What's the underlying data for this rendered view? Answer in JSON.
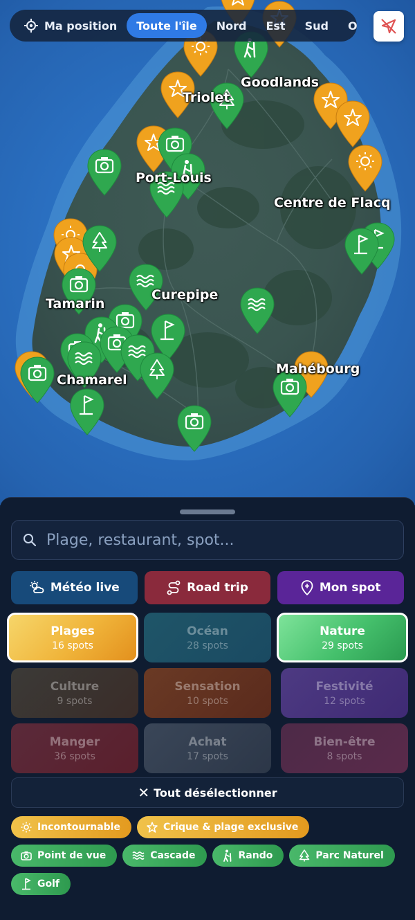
{
  "map": {
    "cities": [
      {
        "id": "goodlands",
        "label": "Goodlands"
      },
      {
        "id": "triolet",
        "label": "Triolet"
      },
      {
        "id": "port-louis",
        "label": "Port-Louis"
      },
      {
        "id": "centre-de-flacq",
        "label": "Centre de Flacq"
      },
      {
        "id": "tamarin",
        "label": "Tamarin"
      },
      {
        "id": "curepipe",
        "label": "Curepipe"
      },
      {
        "id": "chamarel",
        "label": "Chamarel"
      },
      {
        "id": "mahebourg",
        "label": "Mahébourg"
      }
    ],
    "pin_colors": {
      "gold": "#f0a21e",
      "green": "#2fa84f"
    }
  },
  "topbar": {
    "my_position": "Ma position",
    "filters": [
      "Toute l'île",
      "Nord",
      "Est",
      "Sud",
      "O"
    ],
    "active_filter": "Toute l'île"
  },
  "sheet": {
    "search": {
      "placeholder": "Plage, restaurant, spot..."
    },
    "actions": [
      {
        "id": "meteo",
        "label": "Météo live",
        "icon": "sun-cloud-icon",
        "color": "#174a7a"
      },
      {
        "id": "roadtrip",
        "label": "Road trip",
        "icon": "route-icon",
        "color": "#8a2a3c"
      },
      {
        "id": "monspot",
        "label": "Mon spot",
        "icon": "map-pin-plus-icon",
        "color": "#5a2598"
      }
    ],
    "categories": [
      {
        "name": "Plages",
        "count": "16 spots",
        "selected": true
      },
      {
        "name": "Océan",
        "count": "28 spots",
        "selected": false
      },
      {
        "name": "Nature",
        "count": "29 spots",
        "selected": true
      },
      {
        "name": "Culture",
        "count": "9 spots",
        "selected": false
      },
      {
        "name": "Sensation",
        "count": "10 spots",
        "selected": false
      },
      {
        "name": "Festivité",
        "count": "12 spots",
        "selected": false
      },
      {
        "name": "Manger",
        "count": "36 spots",
        "selected": false
      },
      {
        "name": "Achat",
        "count": "17 spots",
        "selected": false
      },
      {
        "name": "Bien-être",
        "count": "8 spots",
        "selected": false
      }
    ],
    "deselect_all": "Tout désélectionner",
    "chips": [
      {
        "label": "Incontournable",
        "icon": "sun-icon",
        "tone": "gold"
      },
      {
        "label": "Crique & plage exclusive",
        "icon": "star-icon",
        "tone": "gold"
      },
      {
        "label": "Point de vue",
        "icon": "camera-icon",
        "tone": "green"
      },
      {
        "label": "Cascade",
        "icon": "waves-icon",
        "tone": "green"
      },
      {
        "label": "Rando",
        "icon": "hiker-icon",
        "tone": "green"
      },
      {
        "label": "Parc Naturel",
        "icon": "tree-icon",
        "tone": "green"
      },
      {
        "label": "Golf",
        "icon": "golf-flag-icon",
        "tone": "green"
      }
    ]
  }
}
